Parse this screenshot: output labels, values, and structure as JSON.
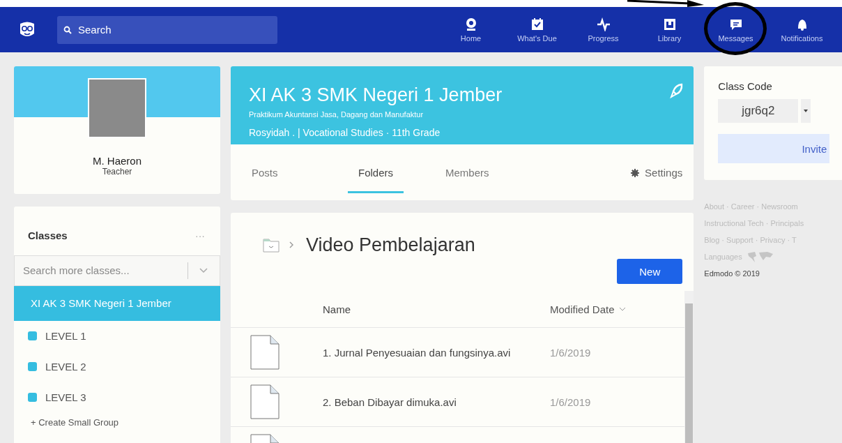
{
  "navbar": {
    "search": {
      "placeholder": "Search"
    },
    "items": [
      {
        "label": "Home",
        "kind": "home",
        "circled": false
      },
      {
        "label": "What's Due",
        "kind": "due",
        "circled": false
      },
      {
        "label": "Progress",
        "kind": "progress",
        "circled": false
      },
      {
        "label": "Library",
        "kind": "library",
        "circled": false
      },
      {
        "label": "Messages",
        "kind": "messages",
        "circled": true
      },
      {
        "label": "Notifications",
        "kind": "notifications",
        "circled": false
      }
    ]
  },
  "profile": {
    "name": "M. Haeron",
    "role": "Teacher"
  },
  "classes": {
    "title": "Classes",
    "menu": "···",
    "search": {
      "placeholder": "Search more classes..."
    },
    "items": [
      {
        "name": "XI AK 3 SMK Negeri 1 Jember",
        "selected": true
      }
    ],
    "groups": [
      {
        "name": "LEVEL 1"
      },
      {
        "name": "LEVEL 2"
      },
      {
        "name": "LEVEL 3"
      }
    ],
    "create": "+ Create Small Group"
  },
  "class_header": {
    "title": "XI AK 3 SMK Negeri 1 Jember",
    "subtitle": "Praktikum Akuntansi Jasa, Dagang dan Manufaktur",
    "meta": "Rosyidah . | Vocational Studies · 11th Grade"
  },
  "tabs": [
    {
      "label": "Posts",
      "selected": false
    },
    {
      "label": "Folders",
      "selected": true
    },
    {
      "label": "Members",
      "selected": false
    }
  ],
  "settings": "Settings",
  "folder": {
    "name": "Video Pembelajaran",
    "new_button": "New",
    "columns": [
      "Name",
      "Modified Date"
    ],
    "rows": [
      {
        "name": "1. Jurnal Penyesuaian dan fungsinya.avi",
        "date": "1/6/2019"
      },
      {
        "name": "2. Beban Dibayar dimuka.avi",
        "date": "1/6/2019"
      }
    ]
  },
  "class_code": {
    "label": "Class Code",
    "code": "jgr6q2",
    "invite": "Invite"
  },
  "footer": {
    "links": [
      "About · Career · Newsroom",
      "Instructional Tech · Principals",
      "Blog · Support · Privacy · T",
      "Languages"
    ],
    "copyright": "Edmodo © 2019"
  }
}
